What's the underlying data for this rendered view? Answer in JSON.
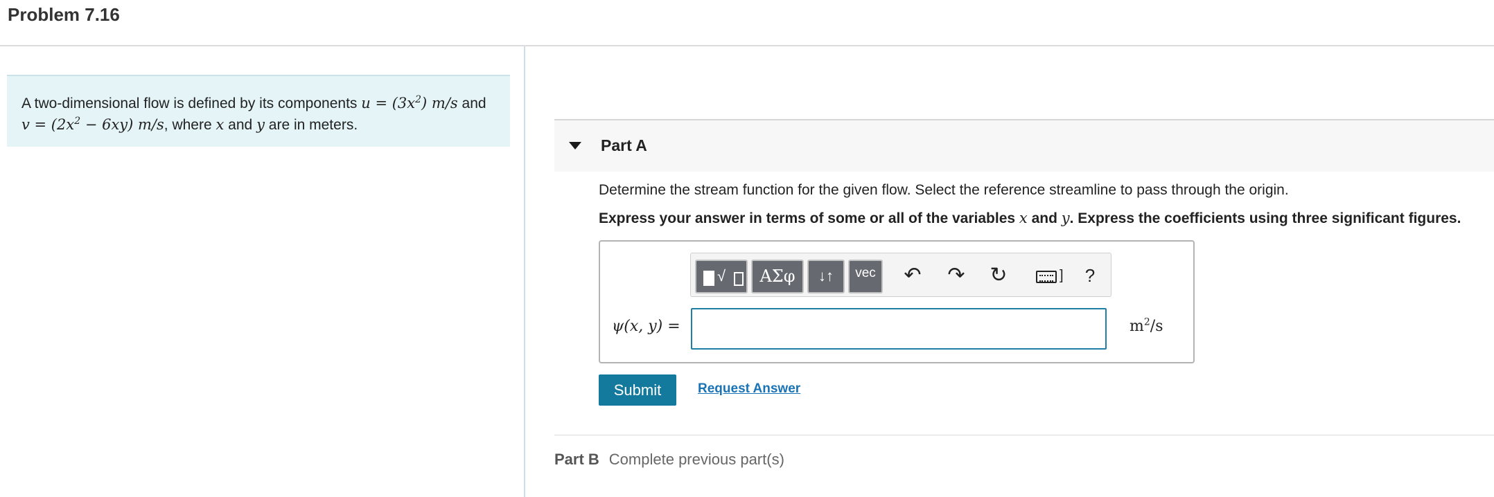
{
  "header": {
    "title": "Problem 7.16"
  },
  "problem": {
    "text_intro": "A two-dimensional flow is defined by its components ",
    "u_expr": "u = (3x",
    "u_exp": "2",
    "u_close": ") m/s",
    "and_1": " and",
    "v_expr": "v = (2x",
    "v_exp": "2",
    "v_rest": " − 6xy) m/s",
    "where": ", where ",
    "x_var": "x",
    "and_2": " and ",
    "y_var": "y",
    "tail": " are in meters."
  },
  "part_a": {
    "label": "Part A",
    "prompt": "Determine the stream function for the given flow. Select the reference streamline to pass through the origin.",
    "instruction_start": "Express your answer in terms of some or all of the variables ",
    "instruction_x": "x",
    "instruction_and": " and ",
    "instruction_y": "y",
    "instruction_end": ". Express the coefficients using three significant figures.",
    "toolbar": {
      "template_icon": "template-sqrt-icon",
      "greek_label": "ΑΣφ",
      "arrows_label": "↓↑",
      "vec_label": "vec",
      "undo_icon": "undo-icon",
      "redo_icon": "redo-icon",
      "reset_icon": "reset-icon",
      "keyboard_icon": "keyboard-icon",
      "help_label": "?"
    },
    "answer_label": "ψ(x, y) =",
    "answer_value": "",
    "units_base": "m",
    "units_exp": "2",
    "units_tail": "/s",
    "submit_label": "Submit",
    "request_label": "Request Answer"
  },
  "part_b": {
    "label": "Part B",
    "status": "Complete previous part(s)"
  },
  "colors": {
    "accent": "#137a9e",
    "problem_bg": "#e4f4f7",
    "link": "#1a73b5",
    "toolbar_button": "#666a70"
  }
}
